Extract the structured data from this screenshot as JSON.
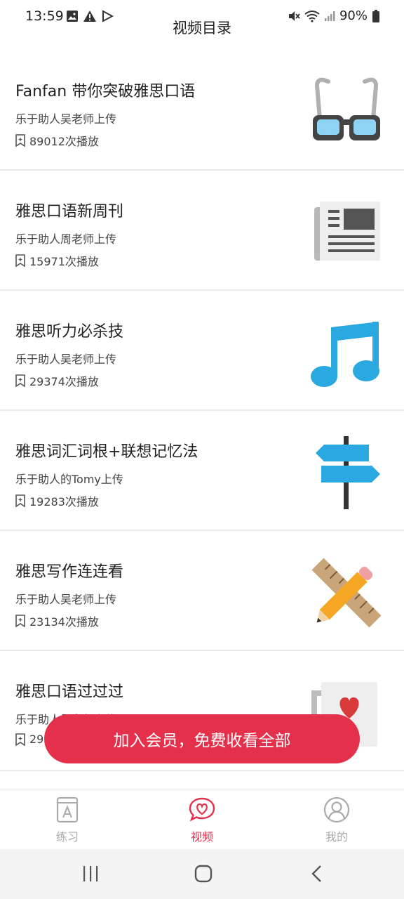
{
  "status_bar": {
    "time": "13:59",
    "battery": "90%"
  },
  "header": {
    "title": "视频目录"
  },
  "videos": [
    {
      "title": "Fanfan 带你突破雅思口语",
      "uploader": "乐于助人吴老师上传",
      "plays": "89012次播放",
      "thumb_icon": "glasses-icon"
    },
    {
      "title": "雅思口语新周刊",
      "uploader": "乐于助人周老师上传",
      "plays": "15971次播放",
      "thumb_icon": "newspaper-icon"
    },
    {
      "title": "雅思听力必杀技",
      "uploader": "乐于助人吴老师上传",
      "plays": "29374次播放",
      "thumb_icon": "music-note-icon"
    },
    {
      "title": "雅思词汇词根+联想记忆法",
      "uploader": "乐于助人的Tomy上传",
      "plays": "19283次播放",
      "thumb_icon": "signpost-icon"
    },
    {
      "title": "雅思写作连连看",
      "uploader": "乐于助人吴老师上传",
      "plays": "23134次播放",
      "thumb_icon": "pencil-ruler-icon"
    },
    {
      "title": "雅思口语过过过",
      "uploader": "乐于助人吴老师上传",
      "plays": "29",
      "thumb_icon": "mug-heart-icon"
    }
  ],
  "member_banner": {
    "label": "加入会员，免费收看全部"
  },
  "tabs": [
    {
      "label": "练习",
      "icon": "book-a-icon",
      "active": false
    },
    {
      "label": "视频",
      "icon": "heart-bubble-icon",
      "active": true
    },
    {
      "label": "我的",
      "icon": "user-icon",
      "active": false
    }
  ],
  "colors": {
    "accent": "#e5304b",
    "inactive": "#aaaaaa",
    "thumb_blue": "#29a9e0"
  }
}
